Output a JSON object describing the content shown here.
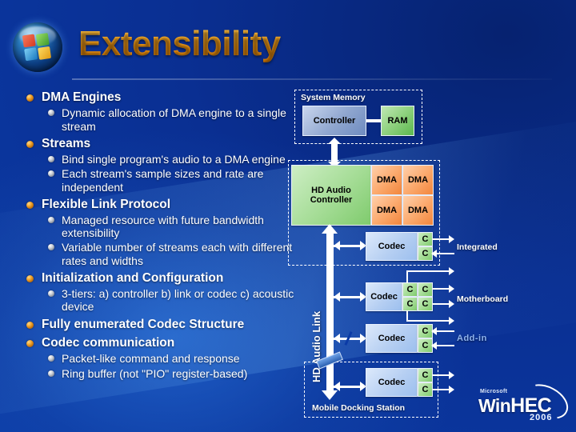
{
  "slide": {
    "title": "Extensibility",
    "logo_icon": "windows-vista-orb-icon"
  },
  "bullets": [
    {
      "level": 1,
      "text": "DMA Engines"
    },
    {
      "level": 2,
      "text": "Dynamic allocation of DMA engine to a single stream"
    },
    {
      "level": 1,
      "text": "Streams"
    },
    {
      "level": 2,
      "text": "Bind single program's audio to a DMA engine"
    },
    {
      "level": 2,
      "text": "Each stream's sample sizes and rate are independent"
    },
    {
      "level": 1,
      "text": "Flexible Link Protocol"
    },
    {
      "level": 2,
      "text": "Managed resource with future bandwidth extensibility"
    },
    {
      "level": 2,
      "text": "Variable number of streams each with different rates and widths"
    },
    {
      "level": 1,
      "text": "Initialization and Configuration"
    },
    {
      "level": 2,
      "text": "3-tiers: a) controller  b) link or codec c) acoustic device"
    },
    {
      "level": 1,
      "text": "Fully enumerated Codec Structure"
    },
    {
      "level": 1,
      "text": "Codec communication"
    },
    {
      "level": 2,
      "text": "Packet-like command and response"
    },
    {
      "level": 2,
      "text": "Ring buffer (not \"PIO\" register-based)"
    }
  ],
  "diagram": {
    "system_memory_label": "System Memory",
    "controller_label": "Controller",
    "ram_label": "RAM",
    "hd_audio_controller_label": "HD Audio\nController",
    "dma_label": "DMA",
    "dma_blocks": [
      "DMA",
      "DMA",
      "DMA",
      "DMA"
    ],
    "hd_audio_link_label": "HD Audio Link",
    "codec_label": "Codec",
    "converter_label": "C",
    "codecs": [
      {
        "name": "Codec",
        "converters": 2,
        "layout": "1x2",
        "zone": "Integrated"
      },
      {
        "name": "Codec",
        "converters": 4,
        "layout": "2x2",
        "zone": "Motherboard"
      },
      {
        "name": "Codec",
        "converters": 2,
        "layout": "1x2",
        "zone": "Add-in"
      },
      {
        "name": "Codec",
        "converters": 2,
        "layout": "1x2",
        "zone": "Mobile Docking Station"
      }
    ],
    "zone_labels": {
      "integrated": "Integrated",
      "motherboard": "Motherboard",
      "addin": "Add-in",
      "mobile_dock": "Mobile Docking Station"
    }
  },
  "footer_logo": {
    "microsoft": "Microsoft",
    "win": "Win",
    "hec": "HEC",
    "year": "2006"
  },
  "colors": {
    "background": "#0a2f92",
    "title": "#f79a12",
    "bullet_level1": "#f0a32a",
    "bullet_level2": "#c8cdd6",
    "block_green": "#8ed17e",
    "block_orange": "#fba86b",
    "block_blue": "#8fa6cf",
    "codec_blue": "#b6cff2",
    "addin_label": "#8fb4ef"
  }
}
